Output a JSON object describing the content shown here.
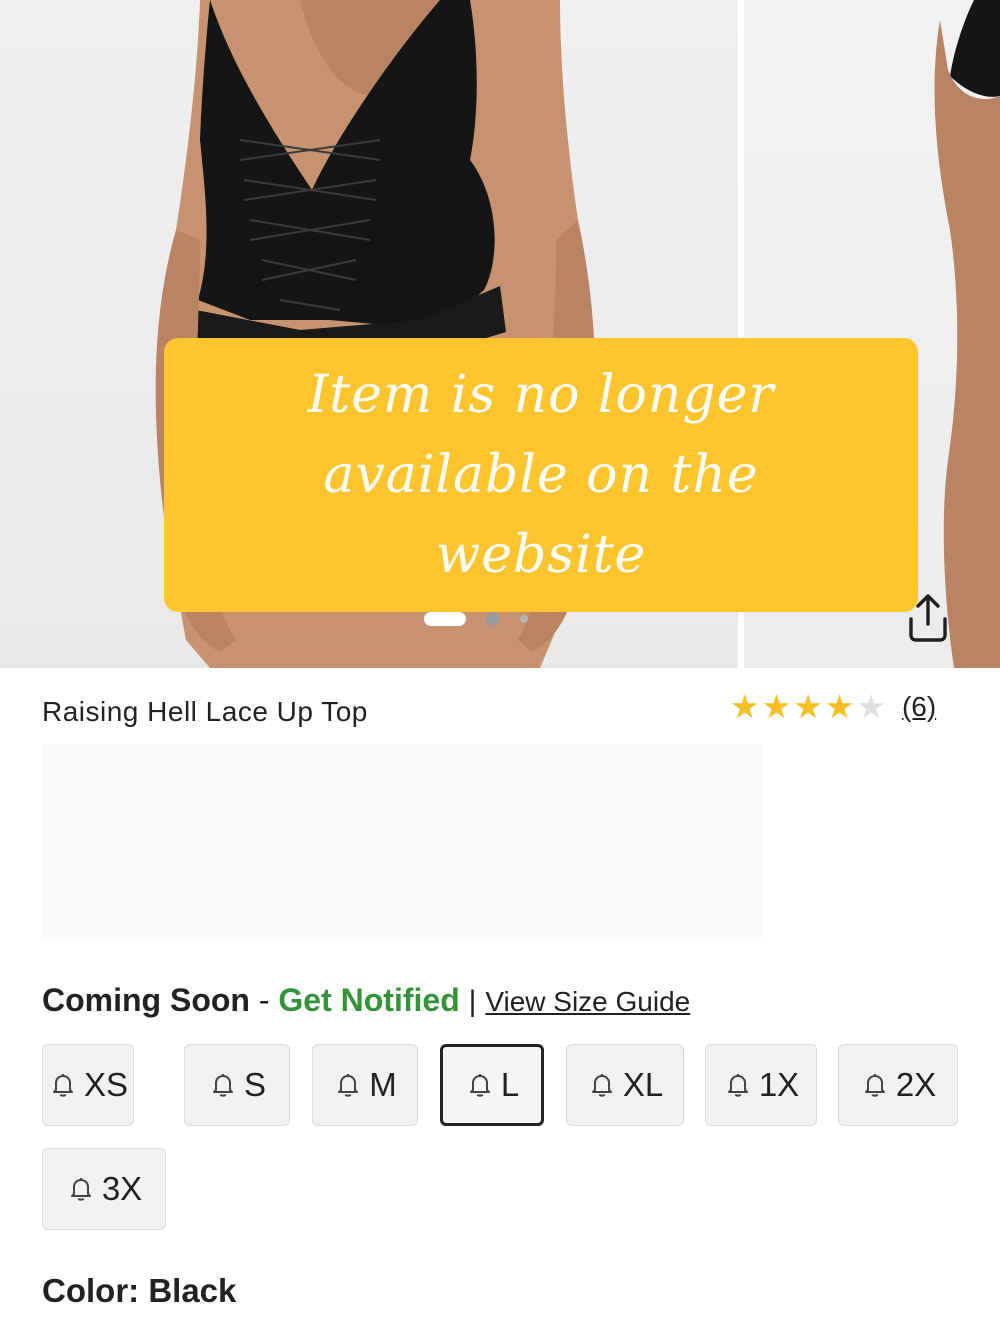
{
  "notice": {
    "text": "Item is no longer available on the website"
  },
  "gallery": {
    "slide_count": 3,
    "active_slide": 1
  },
  "product": {
    "title": "Raising Hell Lace Up Top",
    "rating_value": 4,
    "rating_max": 5,
    "review_count_label": "(6)"
  },
  "availability": {
    "status": "Coming Soon",
    "separator": "-",
    "notify_label": "Get Notified",
    "pipe": "|",
    "size_guide_label": "View Size Guide"
  },
  "sizes": [
    {
      "label": "XS",
      "selected": false
    },
    {
      "label": "S",
      "selected": false
    },
    {
      "label": "M",
      "selected": false
    },
    {
      "label": "L",
      "selected": true
    },
    {
      "label": "XL",
      "selected": false
    },
    {
      "label": "1X",
      "selected": false
    },
    {
      "label": "2X",
      "selected": false
    },
    {
      "label": "3X",
      "selected": false
    }
  ],
  "color": {
    "label": "Color:",
    "value": "Black"
  },
  "icons": {
    "share": "share-icon",
    "size_alert": "bell-icon",
    "star": "star-icon"
  },
  "colors": {
    "notice_bg": "#fec52e",
    "notify_green": "#33923a",
    "star_gold": "#f7c028"
  }
}
